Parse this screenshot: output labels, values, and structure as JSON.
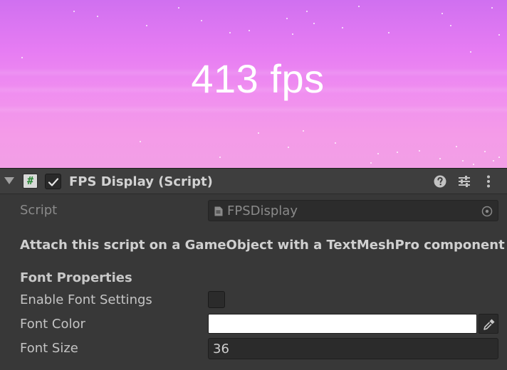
{
  "game_view": {
    "fps_text": "413 fps",
    "colors": {
      "sky_top": "#d070f0",
      "sky_bottom": "#f29fe6",
      "text": "#ffffff"
    }
  },
  "component": {
    "title": "FPS Display (Script)",
    "script_icon_glyph": "#",
    "enabled": true,
    "header_icons": [
      "help-icon",
      "preset-icon",
      "context-menu-icon"
    ]
  },
  "fields": {
    "script_label": "Script",
    "script_value": "FPSDisplay",
    "info": "Attach this script on a GameObject with a TextMeshPro component",
    "section_title": "Font Properties",
    "enable_font_settings_label": "Enable Font Settings",
    "enable_font_settings_checked": false,
    "font_color_label": "Font Color",
    "font_color_value": "#ffffff",
    "font_size_label": "Font Size",
    "font_size_value": "36"
  }
}
